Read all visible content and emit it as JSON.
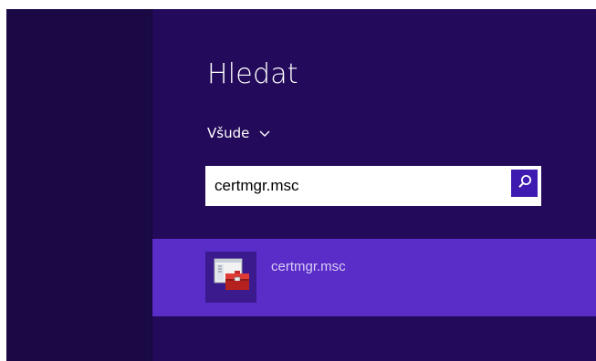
{
  "search_pane": {
    "title": "Hledat",
    "scope_label": "Všude",
    "query": "certmgr.msc",
    "search_icon": "search-icon",
    "scope_icon": "chevron-down-icon"
  },
  "results": [
    {
      "label": "certmgr.msc",
      "icon": "management-console-toolbox-icon"
    }
  ],
  "colors": {
    "background": "#230a5a",
    "rail": "#1a0944",
    "result_highlight": "#5a2cc8",
    "search_button": "#3f1ab0"
  }
}
